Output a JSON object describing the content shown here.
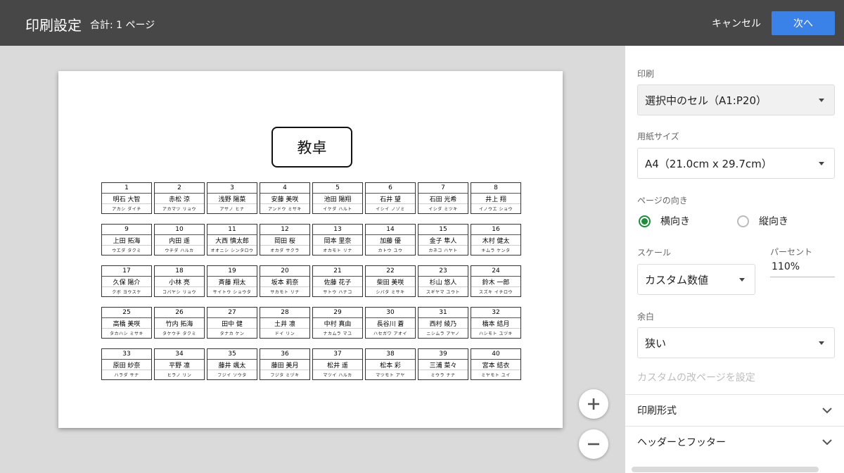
{
  "header": {
    "title": "印刷設定",
    "total": "合計: 1 ページ",
    "cancel_label": "キャンセル",
    "next_label": "次へ"
  },
  "preview": {
    "teacher_desk": "教卓",
    "seats": [
      {
        "num": "1",
        "name": "明石 大智",
        "kana": "アカシ ダイチ"
      },
      {
        "num": "2",
        "name": "赤松 涼",
        "kana": "アカマツ リョウ"
      },
      {
        "num": "3",
        "name": "浅野 陽菜",
        "kana": "アサノ ヒナ"
      },
      {
        "num": "4",
        "name": "安藤 美咲",
        "kana": "アンドウ ミサキ"
      },
      {
        "num": "5",
        "name": "池田 陽翔",
        "kana": "イケダ ハルト"
      },
      {
        "num": "6",
        "name": "石井 望",
        "kana": "イシイ ノゾミ"
      },
      {
        "num": "7",
        "name": "石田 光希",
        "kana": "イシダ ミツキ"
      },
      {
        "num": "8",
        "name": "井上 翔",
        "kana": "イノウエ ショウ"
      },
      {
        "num": "9",
        "name": "上田 拓海",
        "kana": "ウエダ タクミ"
      },
      {
        "num": "10",
        "name": "内田 遥",
        "kana": "ウチダ ハルカ"
      },
      {
        "num": "11",
        "name": "大西 慎太郎",
        "kana": "オオニシ シンタロウ"
      },
      {
        "num": "12",
        "name": "岡田 桜",
        "kana": "オカダ サクラ"
      },
      {
        "num": "13",
        "name": "岡本 里奈",
        "kana": "オカモト リナ"
      },
      {
        "num": "14",
        "name": "加藤 優",
        "kana": "カトウ ユウ"
      },
      {
        "num": "15",
        "name": "金子 隼人",
        "kana": "カネコ ハヤト"
      },
      {
        "num": "16",
        "name": "木村 健太",
        "kana": "キムラ ケンタ"
      },
      {
        "num": "17",
        "name": "久保 陽介",
        "kana": "クボ ヨウスケ"
      },
      {
        "num": "18",
        "name": "小林 亮",
        "kana": "コバヤシ リョウ"
      },
      {
        "num": "19",
        "name": "斉藤 翔太",
        "kana": "サイトウ ショウタ"
      },
      {
        "num": "20",
        "name": "坂本 莉奈",
        "kana": "サカモト リナ"
      },
      {
        "num": "21",
        "name": "佐藤 花子",
        "kana": "サトウ ハナコ"
      },
      {
        "num": "22",
        "name": "柴田 美咲",
        "kana": "シバタ ミサキ"
      },
      {
        "num": "23",
        "name": "杉山 悠人",
        "kana": "スギヤマ ユウト"
      },
      {
        "num": "24",
        "name": "鈴木 一郎",
        "kana": "スズキ イチロウ"
      },
      {
        "num": "25",
        "name": "高橋 美咲",
        "kana": "タカハシ ミサキ"
      },
      {
        "num": "26",
        "name": "竹内 拓海",
        "kana": "タケウチ タクミ"
      },
      {
        "num": "27",
        "name": "田中 健",
        "kana": "タナカ ケン"
      },
      {
        "num": "28",
        "name": "土井 凛",
        "kana": "ドイ リン"
      },
      {
        "num": "29",
        "name": "中村 真由",
        "kana": "ナカムラ マユ"
      },
      {
        "num": "30",
        "name": "長谷川 蒼",
        "kana": "ハセガワ アオイ"
      },
      {
        "num": "31",
        "name": "西村 綾乃",
        "kana": "ニシムラ アヤノ"
      },
      {
        "num": "32",
        "name": "橋本 結月",
        "kana": "ハシモト ユヅキ"
      },
      {
        "num": "33",
        "name": "原田 紗奈",
        "kana": "ハラダ サナ"
      },
      {
        "num": "34",
        "name": "平野 凛",
        "kana": "ヒラノ リン"
      },
      {
        "num": "35",
        "name": "藤井 颯太",
        "kana": "フジイ ソウタ"
      },
      {
        "num": "36",
        "name": "藤田 美月",
        "kana": "フジタ ミヅキ"
      },
      {
        "num": "37",
        "name": "松井 遥",
        "kana": "マツイ ハルカ"
      },
      {
        "num": "38",
        "name": "松本 彩",
        "kana": "マツモト アヤ"
      },
      {
        "num": "39",
        "name": "三浦 菜々",
        "kana": "ミウラ ナナ"
      },
      {
        "num": "40",
        "name": "宮本 結衣",
        "kana": "ミヤモト ユイ"
      }
    ]
  },
  "panel": {
    "print_label": "印刷",
    "print_value": "選択中のセル（A1:P20）",
    "paper_label": "用紙サイズ",
    "paper_value": "A4（21.0cm x 29.7cm）",
    "orientation_label": "ページの向き",
    "landscape_label": "横向き",
    "portrait_label": "縦向き",
    "scale_label": "スケール",
    "scale_value": "カスタム数値",
    "percent_label": "パーセント",
    "percent_value": "110%",
    "margin_label": "余白",
    "margin_value": "狭い",
    "custom_break_label": "カスタムの改ページを設定",
    "format_label": "印刷形式",
    "header_footer_label": "ヘッダーとフッター"
  },
  "colors": {
    "topbar": "#474747",
    "primary_button": "#3b82e8",
    "radio_selected": "#1e8e3e"
  }
}
